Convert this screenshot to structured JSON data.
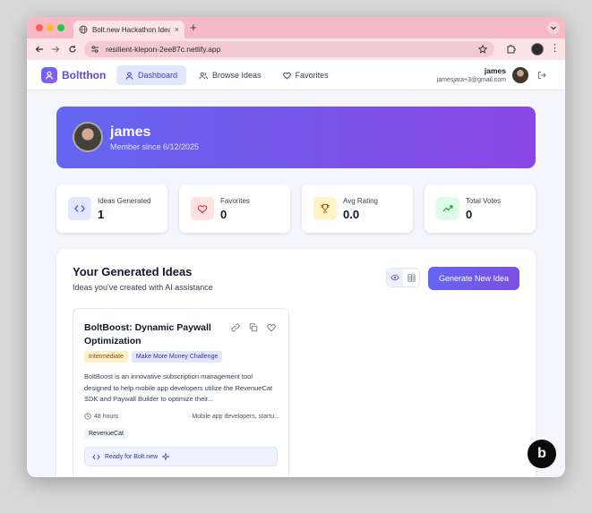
{
  "browser": {
    "tab_title": "Bolt.new Hackathon Idea Gen",
    "tab_close": "×",
    "new_tab": "+",
    "url": "resilient-klepon-2ee87c.netlify.app",
    "menu": "⋮"
  },
  "header": {
    "logo_text": "Boltthon",
    "nav": [
      {
        "label": "Dashboard",
        "icon": "user-icon",
        "active": true
      },
      {
        "label": "Browse Ideas",
        "icon": "users-icon",
        "active": false
      },
      {
        "label": "Favorites",
        "icon": "heart-icon",
        "active": false
      }
    ],
    "user_name": "james",
    "user_email": "jamesjara+3@gmail.com"
  },
  "hero": {
    "name": "james",
    "member_since": "Member since 6/12/2025"
  },
  "stats": [
    {
      "label": "Ideas Generated",
      "value": "1",
      "icon": "code-icon",
      "color": "#e0e7ff"
    },
    {
      "label": "Favorites",
      "value": "0",
      "icon": "heart-icon",
      "color": "#fee2e2"
    },
    {
      "label": "Avg Rating",
      "value": "0.0",
      "icon": "trophy-icon",
      "color": "#fef3c7"
    },
    {
      "label": "Total Votes",
      "value": "0",
      "icon": "trending-up-icon",
      "color": "#dcfce7"
    }
  ],
  "ideas": {
    "title": "Your Generated Ideas",
    "subtitle": "Ideas you've created with AI assistance",
    "generate_label": "Generate New Idea",
    "cards": [
      {
        "title": "BoltBoost: Dynamic Paywall Optimization",
        "level": "Intermediate",
        "challenge": "Make More Money Challenge",
        "description": "BoltBoost is an innovative subscription management tool designed to help mobile app developers utilize the RevenueCat SDK and Paywall Builder to optimize their...",
        "time": "48 hours",
        "audience": "· Mobile app developers, startu...",
        "tech": "RevenueCat",
        "ready": "Ready for Bolt.new"
      }
    ]
  },
  "colors": {
    "accent": "#6366f1",
    "accent_end": "#8b46e6",
    "tab_strip": "#f6b9c6"
  }
}
